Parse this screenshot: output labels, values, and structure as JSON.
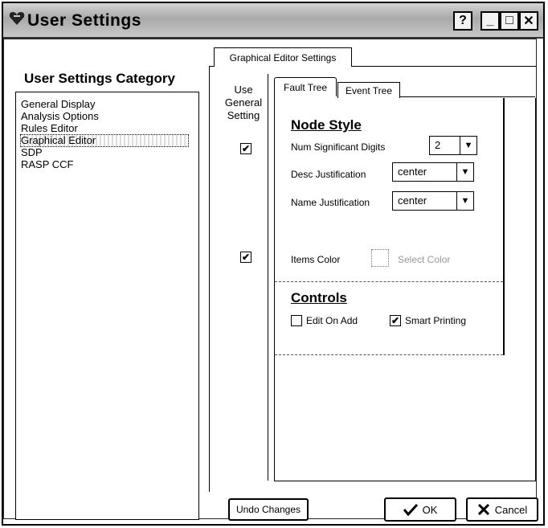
{
  "window": {
    "title": "User Settings",
    "help_label": "?",
    "minimize_label": "_",
    "maximize_label": "□",
    "close_label": "✕"
  },
  "category": {
    "heading": "User Settings Category",
    "items": [
      "General Display",
      "Analysis Options",
      "Rules Editor",
      "Graphical Editor",
      "SDP",
      "RASP CCF"
    ],
    "selected": "Graphical Editor"
  },
  "main_tab": {
    "label": "Graphical Editor Settings"
  },
  "use_general": {
    "line1": "Use",
    "line2": "General",
    "line3": "Setting"
  },
  "use_general_checks": {
    "node_style": true,
    "items_color": true
  },
  "tabs": {
    "fault_tree": "Fault Tree",
    "event_tree": "Event Tree"
  },
  "node_style": {
    "title": "Node Style",
    "num_digits_label": "Num Significant Digits",
    "num_digits_value": "2",
    "desc_just_label": "Desc  Justification",
    "desc_just_value": "center",
    "name_just_label": "Name Justification",
    "name_just_value": "center",
    "items_color_label": "Items Color",
    "select_color_label": "Select Color"
  },
  "controls": {
    "title": "Controls",
    "edit_on_add_label": "Edit On Add",
    "edit_on_add_checked": false,
    "smart_printing_label": "Smart Printing",
    "smart_printing_checked": true
  },
  "buttons": {
    "undo": "Undo Changes",
    "ok": "OK",
    "cancel": "Cancel"
  }
}
